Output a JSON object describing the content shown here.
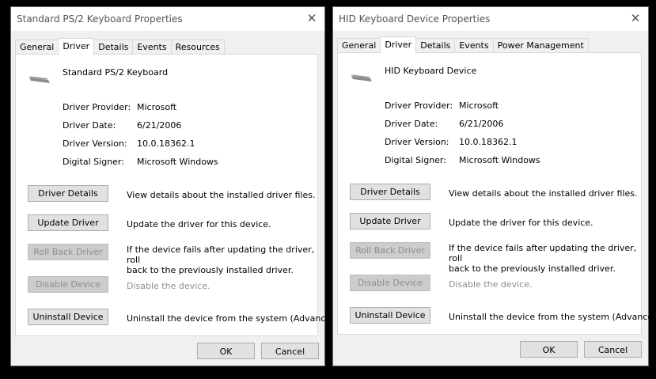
{
  "dialogs": [
    {
      "title": "Standard PS/2 Keyboard Properties",
      "close_glyph": "✕",
      "tabs": [
        "General",
        "Driver",
        "Details",
        "Events",
        "Resources"
      ],
      "active_tab": "Driver",
      "device_icon": "keyboard-icon",
      "device_name": "Standard PS/2 Keyboard",
      "properties": [
        {
          "label": "Driver Provider:",
          "value": "Microsoft"
        },
        {
          "label": "Driver Date:",
          "value": "6/21/2006"
        },
        {
          "label": "Driver Version:",
          "value": "10.0.18362.1"
        },
        {
          "label": "Digital Signer:",
          "value": "Microsoft Windows"
        }
      ],
      "actions": [
        {
          "label": "Driver Details",
          "desc": "View details about the installed driver files.",
          "enabled": true
        },
        {
          "label": "Update Driver",
          "desc": "Update the driver for this device.",
          "enabled": true
        },
        {
          "label": "Roll Back Driver",
          "desc": "If the device fails after updating the driver, roll\nback to the previously installed driver.",
          "enabled": false
        },
        {
          "label": "Disable Device",
          "desc": "Disable the device.",
          "enabled": false
        },
        {
          "label": "Uninstall Device",
          "desc": "Uninstall the device from the system (Advanced).",
          "enabled": true
        }
      ],
      "ok_label": "OK",
      "cancel_label": "Cancel"
    },
    {
      "title": "HID Keyboard Device Properties",
      "close_glyph": "✕",
      "tabs": [
        "General",
        "Driver",
        "Details",
        "Events",
        "Power Management"
      ],
      "active_tab": "Driver",
      "device_icon": "keyboard-icon",
      "device_name": "HID Keyboard Device",
      "properties": [
        {
          "label": "Driver Provider:",
          "value": "Microsoft"
        },
        {
          "label": "Driver Date:",
          "value": "6/21/2006"
        },
        {
          "label": "Driver Version:",
          "value": "10.0.18362.1"
        },
        {
          "label": "Digital Signer:",
          "value": "Microsoft Windows"
        }
      ],
      "actions": [
        {
          "label": "Driver Details",
          "desc": "View details about the installed driver files.",
          "enabled": true
        },
        {
          "label": "Update Driver",
          "desc": "Update the driver for this device.",
          "enabled": true
        },
        {
          "label": "Roll Back Driver",
          "desc": "If the device fails after updating the driver, roll\nback to the previously installed driver.",
          "enabled": false
        },
        {
          "label": "Disable Device",
          "desc": "Disable the device.",
          "enabled": false
        },
        {
          "label": "Uninstall Device",
          "desc": "Uninstall the device from the system (Advanced).",
          "enabled": true
        }
      ],
      "ok_label": "OK",
      "cancel_label": "Cancel"
    }
  ]
}
